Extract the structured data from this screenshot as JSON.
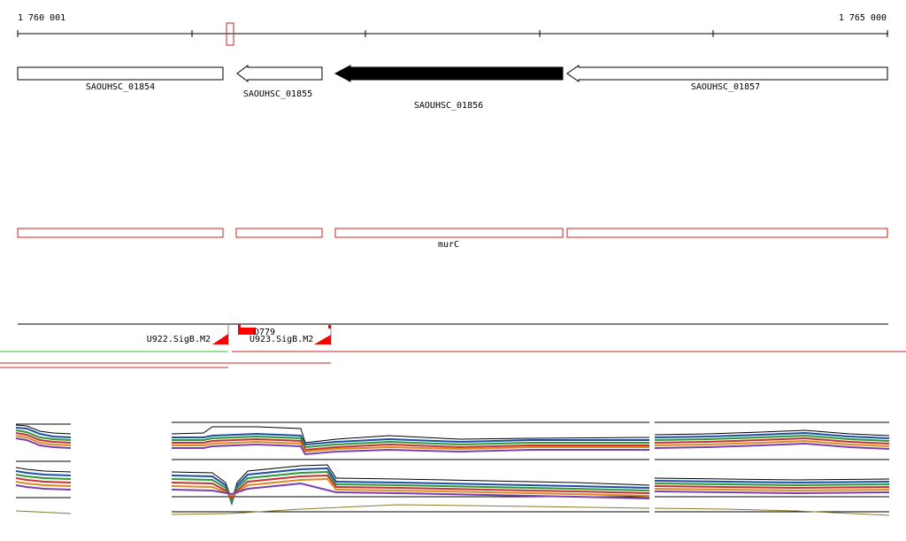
{
  "ruler": {
    "start_label": "1 760 001",
    "end_label": "1 765 000"
  },
  "genes": [
    {
      "id": "SAOUHSC_01854",
      "strand": "minus",
      "selected": false
    },
    {
      "id": "SAOUHSC_01855",
      "strand": "minus",
      "selected": false
    },
    {
      "id": "SAOUHSC_01856",
      "strand": "minus",
      "selected": true
    },
    {
      "id": "SAOUHSC_01857",
      "strand": "minus",
      "selected": false
    }
  ],
  "gene_names": [
    {
      "name": ""
    },
    {
      "name": ""
    },
    {
      "name": "murC"
    },
    {
      "name": ""
    }
  ],
  "features": [
    {
      "name": "U922.SigB.M2"
    },
    {
      "name": "D779"
    },
    {
      "name": "U923.SigB.M2"
    }
  ],
  "colors": {
    "selected_gene": "#000000",
    "name_box": "#cc2222",
    "feature_marker": "#ff0000",
    "forward_line": "#33bb33",
    "reverse_line": "#cc2222"
  }
}
